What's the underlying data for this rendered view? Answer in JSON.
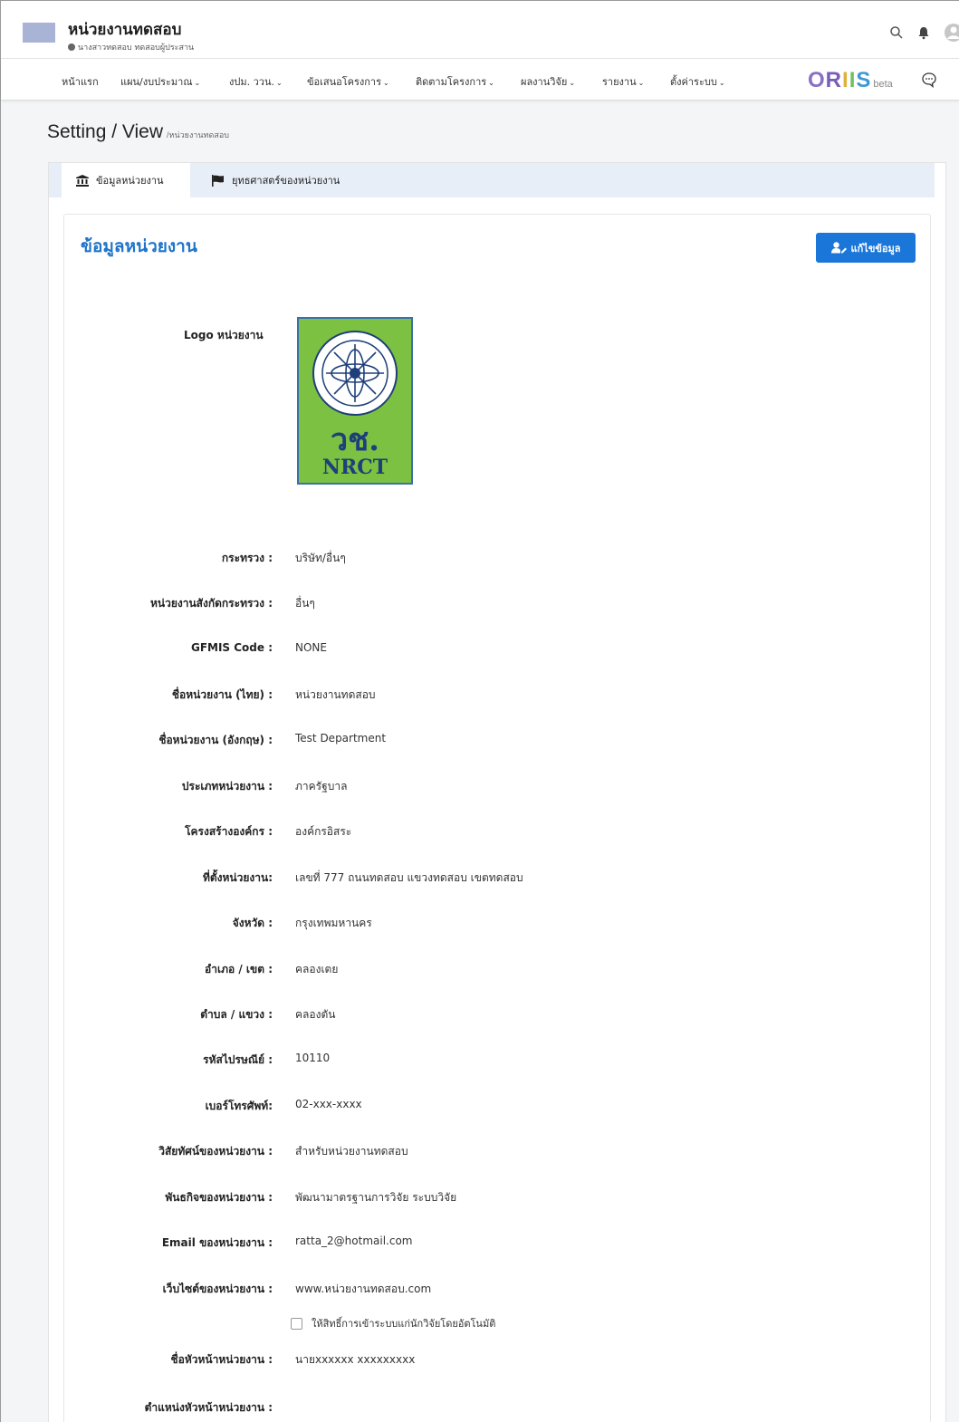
{
  "header": {
    "org_title": "หน่วยงานทดสอบ",
    "org_user": "นางสาวทดสอบ ทดสอบผู้ประสาน"
  },
  "nav": {
    "items": [
      {
        "label": "หน้าแรก",
        "dropdown": false
      },
      {
        "label": "แผน/งบประมาณ",
        "dropdown": true
      },
      {
        "label": "งปม. ววน.",
        "dropdown": true
      },
      {
        "label": "ข้อเสนอโครงการ",
        "dropdown": true
      },
      {
        "label": "ติดตามโครงการ",
        "dropdown": true
      },
      {
        "label": "ผลงานวิจัย",
        "dropdown": true
      },
      {
        "label": "รายงาน",
        "dropdown": true
      },
      {
        "label": "ตั้งค่าระบบ",
        "dropdown": true
      }
    ],
    "brand": "ORIIS",
    "brand_suffix": "beta"
  },
  "page": {
    "title": "Setting / View",
    "breadcrumb": "/หน่วยงานทดสอบ"
  },
  "tabs": [
    {
      "label": "ข้อมูลหน่วยงาน",
      "icon": "bank-icon"
    },
    {
      "label": "ยุทธศาสตร์ของหน่วยงาน",
      "icon": "flag-icon"
    }
  ],
  "section": {
    "title": "ข้อมูลหน่วยงาน",
    "edit_label": "แก้ไขข้อมูล",
    "logo_label": "Logo หน่วยงาน",
    "logo_text_thai": "วช.",
    "logo_text_en": "NRCT"
  },
  "fields": [
    {
      "label": "กระทรวง :",
      "value": "บริษัท/อื่นๆ"
    },
    {
      "label": "หน่วยงานสังกัดกระทรวง :",
      "value": "อื่นๆ"
    },
    {
      "label": "GFMIS Code :",
      "value": "NONE"
    },
    {
      "label": "ชื่อหน่วยงาน (ไทย) :",
      "value": "หน่วยงานทดสอบ"
    },
    {
      "label": "ชื่อหน่วยงาน (อังกฤษ) :",
      "value": "Test Department"
    },
    {
      "label": "ประเภทหน่วยงาน :",
      "value": "ภาครัฐบาล"
    },
    {
      "label": "โครงสร้างองค์กร :",
      "value": "องค์กรอิสระ"
    },
    {
      "label": "ที่ตั้งหน่วยงาน:",
      "value": "เลขที่ 777 ถนนทดสอบ แขวงทดสอบ เขตทดสอบ"
    },
    {
      "label": "จังหวัด :",
      "value": "กรุงเทพมหานคร"
    },
    {
      "label": "อำเภอ / เขต :",
      "value": "คลองเตย"
    },
    {
      "label": "ตำบล / แขวง :",
      "value": "คลองตัน"
    },
    {
      "label": "รหัสไปรษณีย์ :",
      "value": "10110"
    },
    {
      "label": "เบอร์โทรศัพท์:",
      "value": "02-xxx-xxxx"
    },
    {
      "label": "วิสัยทัศน์ของหน่วยงาน :",
      "value": "สำหรับหน่วยงานทดสอบ"
    },
    {
      "label": "พันธกิจของหน่วยงาน :",
      "value": "พัฒนามาตรฐานการวิจัย ระบบวิจัย"
    },
    {
      "label": "Email ของหน่วยงาน :",
      "value": "ratta_2@hotmail.com"
    },
    {
      "label": "เว็บไซต์ของหน่วยงาน :",
      "value": "www.หน่วยงานทดสอบ.com"
    }
  ],
  "auto_access_checkbox": {
    "label": "ให้สิทธิ์การเข้าระบบแก่นักวิจัยโดยอัตโนมัติ",
    "checked": false
  },
  "fields_after": [
    {
      "label": "ชื่อหัวหน้าหน่วยงาน :",
      "value": "นายxxxxxx xxxxxxxxx"
    },
    {
      "label": "ตำแหน่งหัวหน้าหน่วยงาน :",
      "value": ""
    }
  ],
  "colors": {
    "accent": "#1a76d9",
    "title_blue": "#1f74c9",
    "tab_bar": "#e8eef7",
    "logo_green": "#7cc142"
  }
}
